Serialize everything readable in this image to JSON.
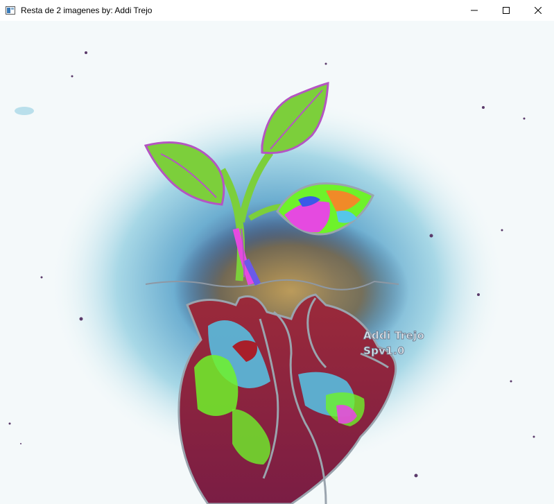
{
  "window": {
    "title": "Resta de 2 imagenes by: Addi Trejo",
    "controls": {
      "minimize": "minimize-icon",
      "maximize": "maximize-icon",
      "close": "close-icon"
    }
  },
  "artwork": {
    "signature_line1": "Addi Trejo",
    "signature_line2": "Spv1.0",
    "palette": {
      "background": "#f4f9fa",
      "halo": "#7ec6dc",
      "halo_dark": "#2b4f86",
      "leaf": "#7ccf3b",
      "leaf_outline": "#b455c2",
      "heart": "#8a2446",
      "heart_cyan": "#55c6e8",
      "heart_green": "#6ef22a",
      "magenta": "#e54ae0"
    }
  }
}
